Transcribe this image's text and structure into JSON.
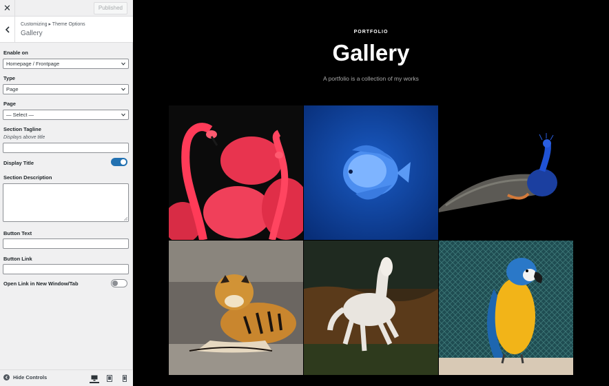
{
  "topbar": {
    "close_icon": "close-icon",
    "publish_label": "Published"
  },
  "section": {
    "breadcrumb": "Customizing ▸ Theme Options",
    "title": "Gallery"
  },
  "controls": {
    "enable_on": {
      "label": "Enable on",
      "value": "Homepage / Frontpage"
    },
    "type": {
      "label": "Type",
      "value": "Page"
    },
    "page": {
      "label": "Page",
      "value": "— Select —"
    },
    "section_tagline": {
      "label": "Section Tagline",
      "description": "Displays above title",
      "value": ""
    },
    "display_title": {
      "label": "Display Title",
      "checked": true
    },
    "section_description": {
      "label": "Section Description",
      "value": ""
    },
    "button_text": {
      "label": "Button Text",
      "value": ""
    },
    "button_link": {
      "label": "Button Link",
      "value": ""
    },
    "open_new_window": {
      "label": "Open Link in New Window/Tab",
      "checked": false
    }
  },
  "footer": {
    "hide_controls_label": "Hide Controls",
    "devices": [
      "desktop-icon",
      "tablet-icon",
      "mobile-icon"
    ],
    "active_device": "desktop"
  },
  "preview": {
    "tagline": "PORTFOLIO",
    "title": "Gallery",
    "description": "A portfolio is a collection of my works",
    "images": [
      "flamingo",
      "blue-fish",
      "peacock",
      "tiger",
      "white-horse",
      "macaw"
    ]
  },
  "colors": {
    "accent": "#2271b1",
    "preview_bg": "#000000",
    "sidebar_bg": "#f0f0f1"
  }
}
